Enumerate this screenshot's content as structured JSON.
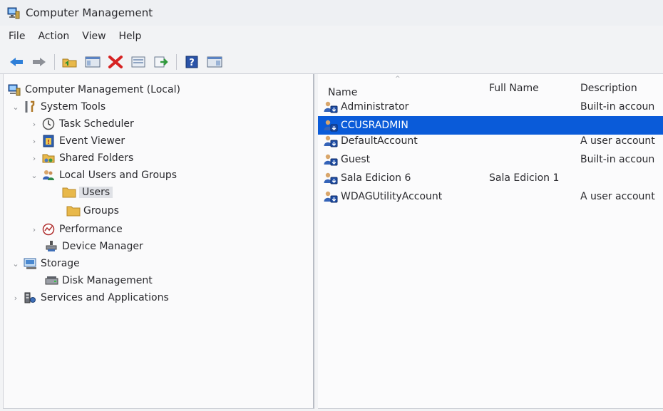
{
  "window": {
    "title": "Computer Management"
  },
  "menu": [
    "File",
    "Action",
    "View",
    "Help"
  ],
  "toolbar": {
    "icons": [
      "back-arrow-icon",
      "forward-arrow-icon",
      "up-folder-icon",
      "show-hide-tree-icon",
      "delete-icon",
      "properties-icon",
      "export-list-icon",
      "help-icon",
      "show-action-pane-icon"
    ]
  },
  "tree": {
    "root": "Computer Management (Local)",
    "system_tools": "System Tools",
    "task_scheduler": "Task Scheduler",
    "event_viewer": "Event Viewer",
    "shared_folders": "Shared Folders",
    "local_users_groups": "Local Users and Groups",
    "users": "Users",
    "groups": "Groups",
    "performance": "Performance",
    "device_manager": "Device Manager",
    "storage": "Storage",
    "disk_management": "Disk Management",
    "services_apps": "Services and Applications"
  },
  "list": {
    "columns": {
      "name": "Name",
      "full_name": "Full Name",
      "description": "Description"
    },
    "rows": [
      {
        "name": "Administrator",
        "full_name": "",
        "description": "Built-in accoun"
      },
      {
        "name": "CCUSRADMIN",
        "full_name": "",
        "description": ""
      },
      {
        "name": "DefaultAccount",
        "full_name": "",
        "description": "A user account"
      },
      {
        "name": "Guest",
        "full_name": "",
        "description": "Built-in accoun"
      },
      {
        "name": "Sala Edicion 6",
        "full_name": "Sala Edicion 1",
        "description": ""
      },
      {
        "name": "WDAGUtilityAccount",
        "full_name": "",
        "description": "A user account"
      }
    ],
    "selected_index": 1
  },
  "colors": {
    "selection": "#0a5bd9",
    "folder": "#e8b84a"
  }
}
